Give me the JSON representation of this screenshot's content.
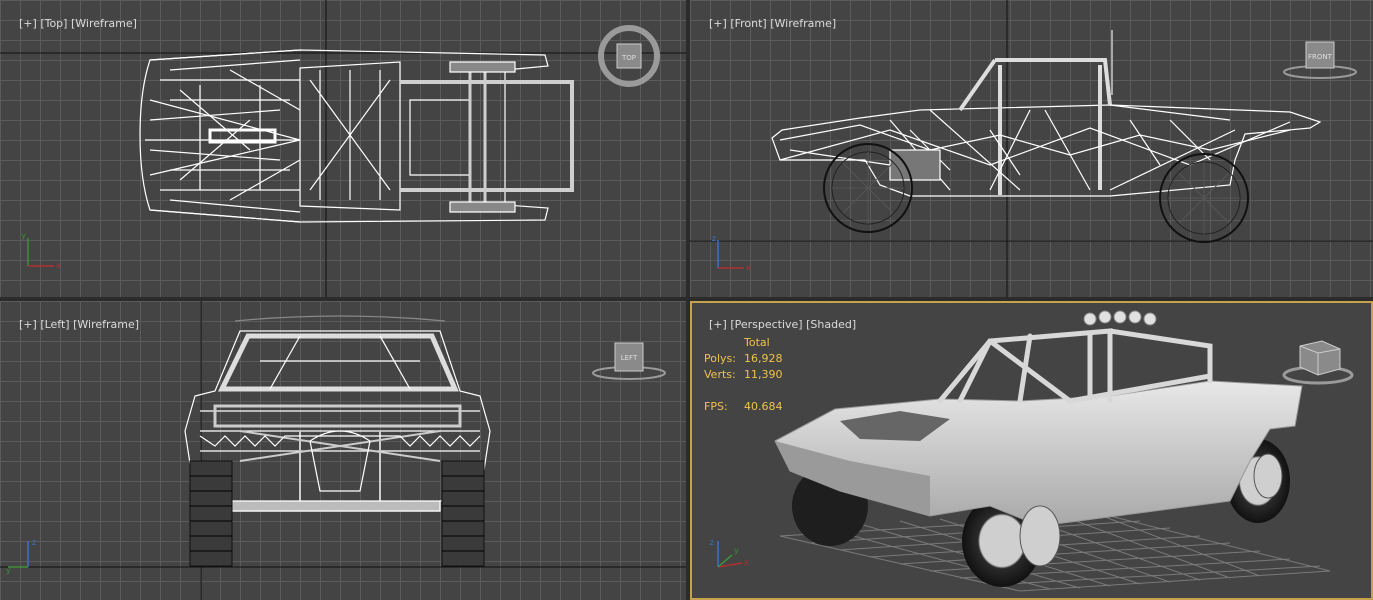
{
  "viewports": {
    "top": {
      "plus": "[+]",
      "view": "[Top]",
      "mode": "[Wireframe]",
      "cube_label": "TOP"
    },
    "front": {
      "plus": "[+]",
      "view": "[Front]",
      "mode": "[Wireframe]",
      "cube_label": "FRONT"
    },
    "left": {
      "plus": "[+]",
      "view": "[Left]",
      "mode": "[Wireframe]",
      "cube_label": "LEFT"
    },
    "perspective": {
      "plus": "[+]",
      "view": "[Perspective]",
      "mode": "[Shaded]"
    }
  },
  "stats": {
    "header": "Total",
    "polys_label": "Polys:",
    "polys_value": "16,928",
    "verts_label": "Verts:",
    "verts_value": "11,390",
    "fps_label": "FPS:",
    "fps_value": "40.684"
  },
  "axis": {
    "x": "x",
    "y": "y",
    "z": "z"
  },
  "colors": {
    "viewport_bg": "#444444",
    "grid": "#5b5b5b",
    "wire": "#ffffff",
    "active_border": "#c8a24a",
    "stats_text": "#f0c24a"
  },
  "icons": [
    "viewcube-top-icon",
    "viewcube-front-icon",
    "viewcube-left-icon",
    "viewcube-perspective-icon",
    "axis-tripod-icon"
  ]
}
